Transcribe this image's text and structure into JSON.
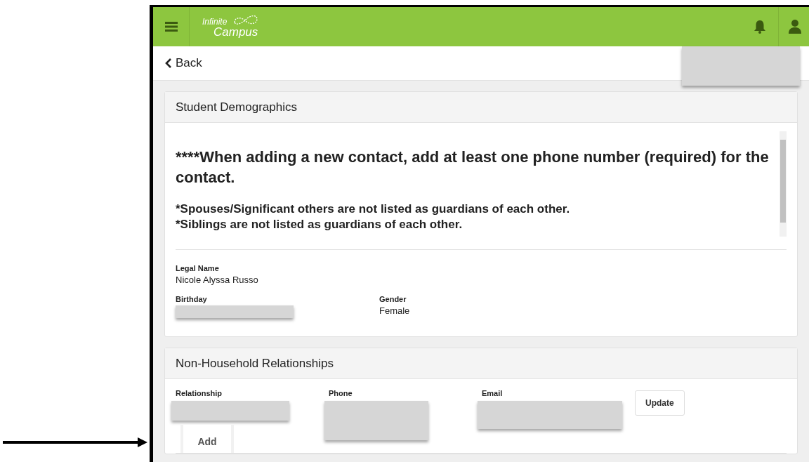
{
  "header": {
    "logo_top": "Infinite",
    "logo_bottom": "Campus"
  },
  "nav": {
    "back": "Back"
  },
  "demographics": {
    "title": "Student Demographics",
    "notice": "****When adding a new contact, add at least one phone number (required) for the contact.",
    "notes": [
      "*Spouses/Significant others are not listed as guardians of each other.",
      "*Siblings are not listed as guardians of each other."
    ],
    "fields": [
      {
        "label": "Legal Name",
        "value": "Nicole Alyssa Russo"
      },
      {
        "label": "Birthday",
        "redacted": true
      },
      {
        "label": "Gender",
        "value": "Female"
      }
    ]
  },
  "relationships": {
    "title": "Non-Household Relationships",
    "columns": [
      "Relationship",
      "Phone",
      "Email"
    ],
    "update": "Update",
    "add": "Add"
  }
}
